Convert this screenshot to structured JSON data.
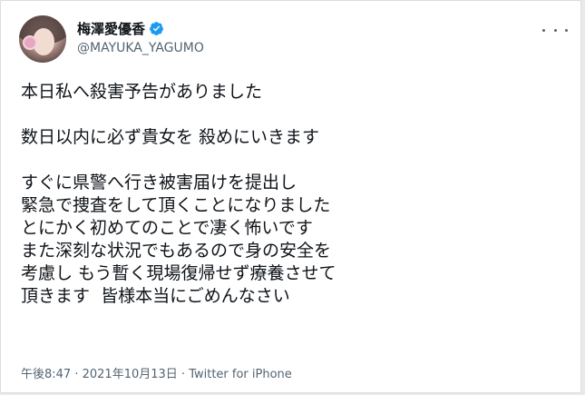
{
  "tweet": {
    "display_name": "梅澤愛優香",
    "handle": "@MAYUKA_YAGUMO",
    "verified_icon": "verified-badge-icon",
    "more_icon": "more-dots-icon",
    "lines": [
      "本日私へ殺害予告がありました",
      "",
      "数日以内に必ず貴女を 殺めにいきます",
      "",
      "すぐに県警へ行き被害届けを提出し",
      "緊急で捜査をして頂くことになりました",
      "とにかく初めてのことで凄く怖いです",
      "また深刻な状況でもあるので身の安全を",
      "考慮し もう暫く現場復帰せず療養させて",
      "頂きます  皆様本当にごめんなさい"
    ],
    "time": "午後8:47",
    "date": "2021年10月13日",
    "source": "Twitter for iPhone",
    "separator": " · "
  },
  "colors": {
    "verified": "#1d9bf0",
    "text": "#0f1419",
    "secondary": "#536471"
  }
}
